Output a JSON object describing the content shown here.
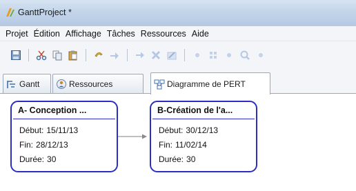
{
  "window": {
    "title": "GanttProject *"
  },
  "menu": [
    "Projet",
    "Édition",
    "Affichage",
    "Tâches",
    "Ressources",
    "Aide"
  ],
  "tabs": [
    {
      "label": "Gantt",
      "icon": "gantt-icon"
    },
    {
      "label": "Ressources",
      "icon": "resources-icon"
    },
    {
      "label": "Diagramme de PERT",
      "icon": "pert-icon",
      "active": true
    }
  ],
  "toolbar": {
    "icons": [
      "save-icon",
      "cut-icon",
      "copy-icon",
      "paste-icon",
      "undo-icon",
      "redo-icon",
      "indent-icon",
      "delete-icon",
      "properties-icon",
      "zoom-out-icon",
      "fit-icon",
      "zoom-reset-icon",
      "zoom-in-icon"
    ]
  },
  "pert": {
    "tasks": [
      {
        "name": "A- Conception ...",
        "start_label": "Début:",
        "start": "15/11/13",
        "end_label": "Fin:",
        "end": "28/12/13",
        "duration_label": "Durée:",
        "duration": "30"
      },
      {
        "name": "B-Création de l'a...",
        "start_label": "Début:",
        "start": "30/12/13",
        "end_label": "Fin:",
        "end": "11/02/14",
        "duration_label": "Durée:",
        "duration": "30"
      }
    ],
    "border_color": "#2a2fbf"
  }
}
